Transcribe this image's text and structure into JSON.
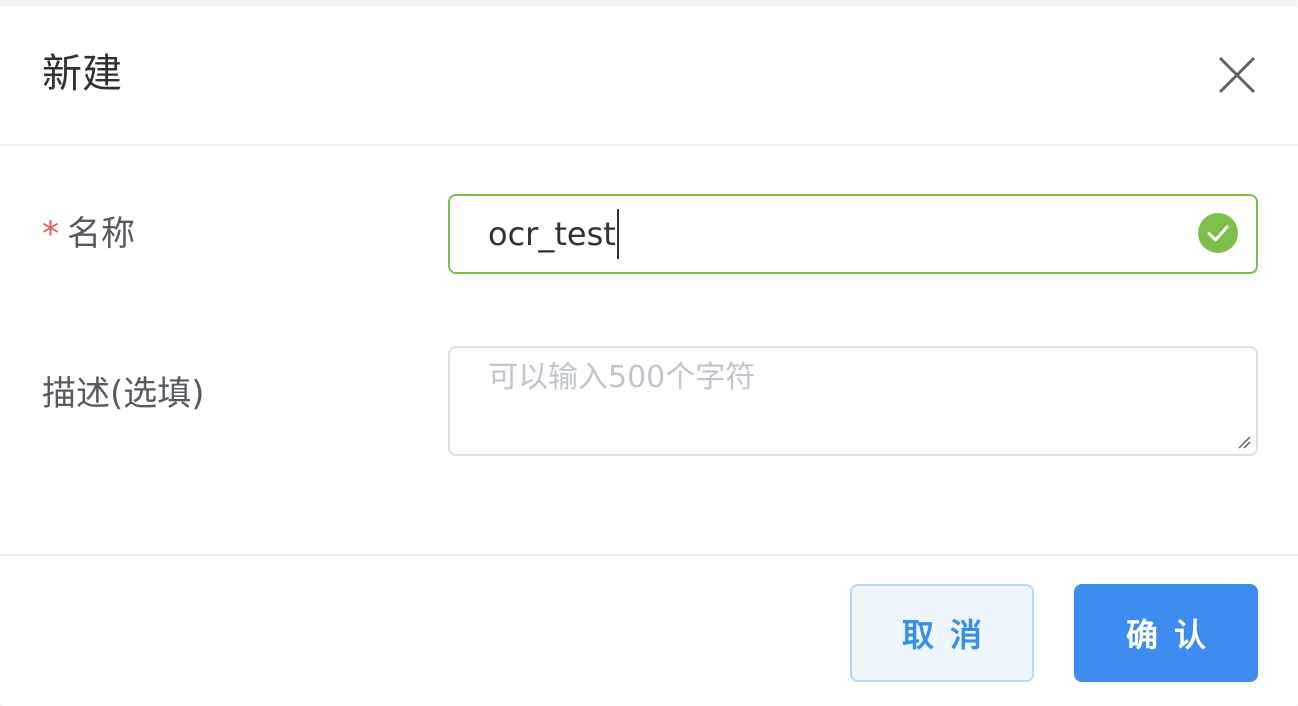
{
  "dialog": {
    "title": "新建",
    "close_icon": "close-icon"
  },
  "form": {
    "name": {
      "required_mark": "*",
      "label": "名称",
      "value": "ocr_test",
      "status_icon": "check-circle-icon",
      "status_color": "#7cbf4a"
    },
    "description": {
      "label": "描述(选填)",
      "value": "",
      "placeholder": "可以输入500个字符"
    }
  },
  "footer": {
    "cancel_label": "取消",
    "confirm_label": "确认"
  },
  "colors": {
    "primary": "#3f8cf0",
    "success": "#7cbf4a",
    "required": "#e05a5a"
  }
}
